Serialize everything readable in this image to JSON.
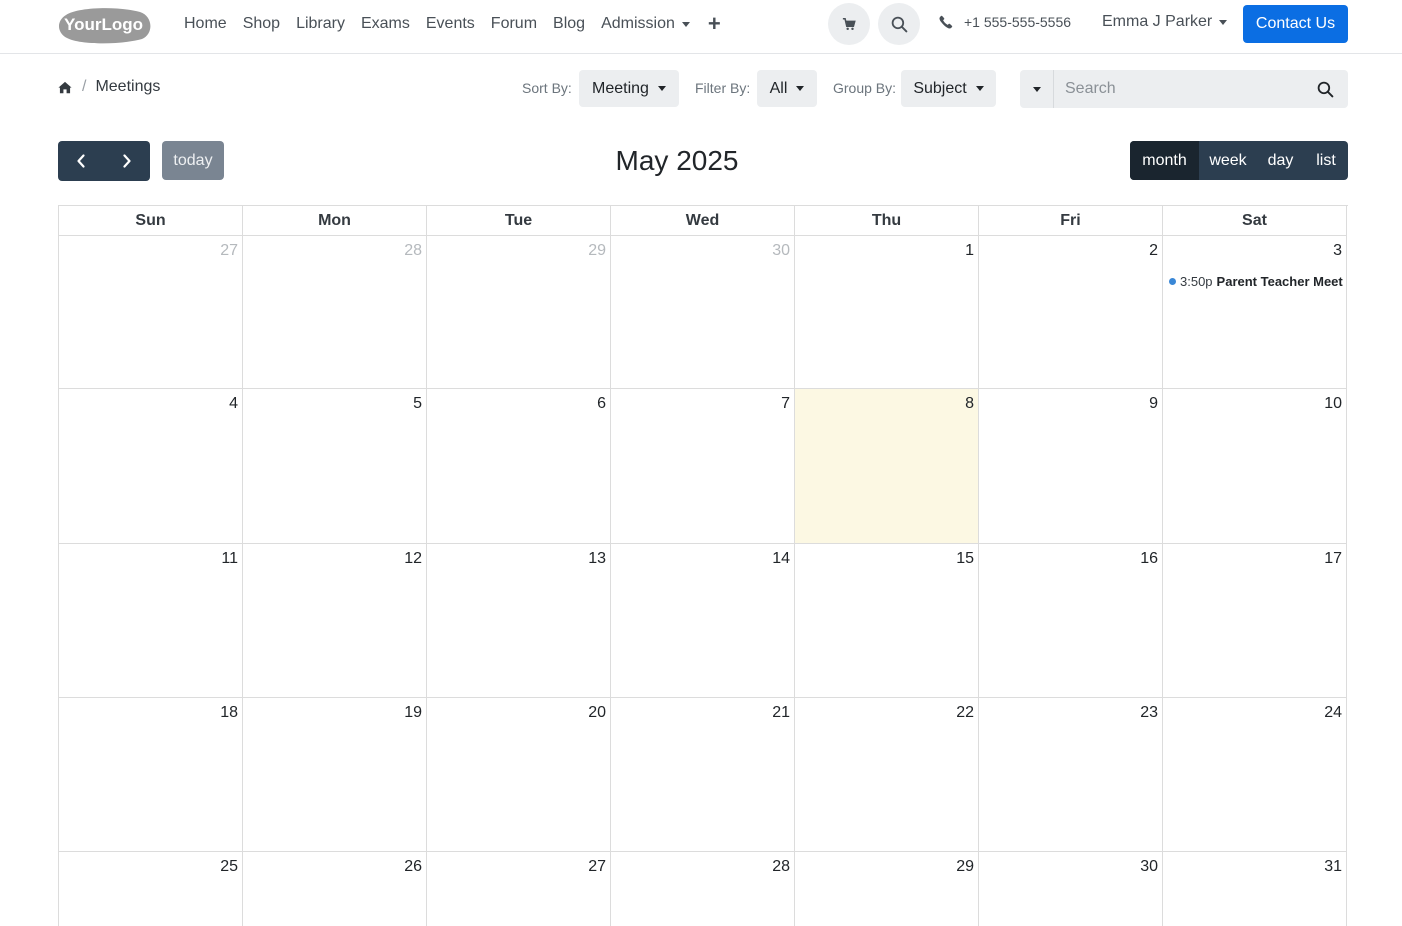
{
  "navbar": {
    "logo_text": "YourLogo",
    "links": [
      "Home",
      "Shop",
      "Library",
      "Exams",
      "Events",
      "Forum",
      "Blog"
    ],
    "admission_label": "Admission",
    "plus_label": "+",
    "phone": "+1 555-555-5556",
    "user_name": "Emma J Parker",
    "contact_label": "Contact Us",
    "accent_color": "#0b6ee3"
  },
  "breadcrumb": {
    "home_icon": "home-icon",
    "separator": "/",
    "current": "Meetings"
  },
  "toolbar": {
    "sort_label": "Sort By:",
    "sort_value": "Meeting",
    "filter_label": "Filter By:",
    "filter_value": "All",
    "group_label": "Group By:",
    "group_value": "Subject",
    "search_placeholder": "Search"
  },
  "calendar": {
    "title": "May 2025",
    "today_label": "today",
    "views": [
      "month",
      "week",
      "day",
      "list"
    ],
    "active_view": "month",
    "weekdays": [
      "Sun",
      "Mon",
      "Tue",
      "Wed",
      "Thu",
      "Fri",
      "Sat"
    ],
    "weeks": [
      [
        "27",
        "28",
        "29",
        "30",
        "1",
        "2",
        "3"
      ],
      [
        "4",
        "5",
        "6",
        "7",
        "8",
        "9",
        "10"
      ],
      [
        "11",
        "12",
        "13",
        "14",
        "15",
        "16",
        "17"
      ],
      [
        "18",
        "19",
        "20",
        "21",
        "22",
        "23",
        "24"
      ],
      [
        "25",
        "26",
        "27",
        "28",
        "29",
        "30",
        "31"
      ]
    ],
    "other_month_days": [
      [
        0,
        0
      ],
      [
        0,
        1
      ],
      [
        0,
        2
      ],
      [
        0,
        3
      ]
    ],
    "today_cell": [
      1,
      4
    ],
    "today_color": "#fcf8e3",
    "events": [
      {
        "week": 0,
        "day": 6,
        "time": "3:50p",
        "title": "Parent Teacher Meet",
        "color": "#3a87d6"
      }
    ]
  }
}
